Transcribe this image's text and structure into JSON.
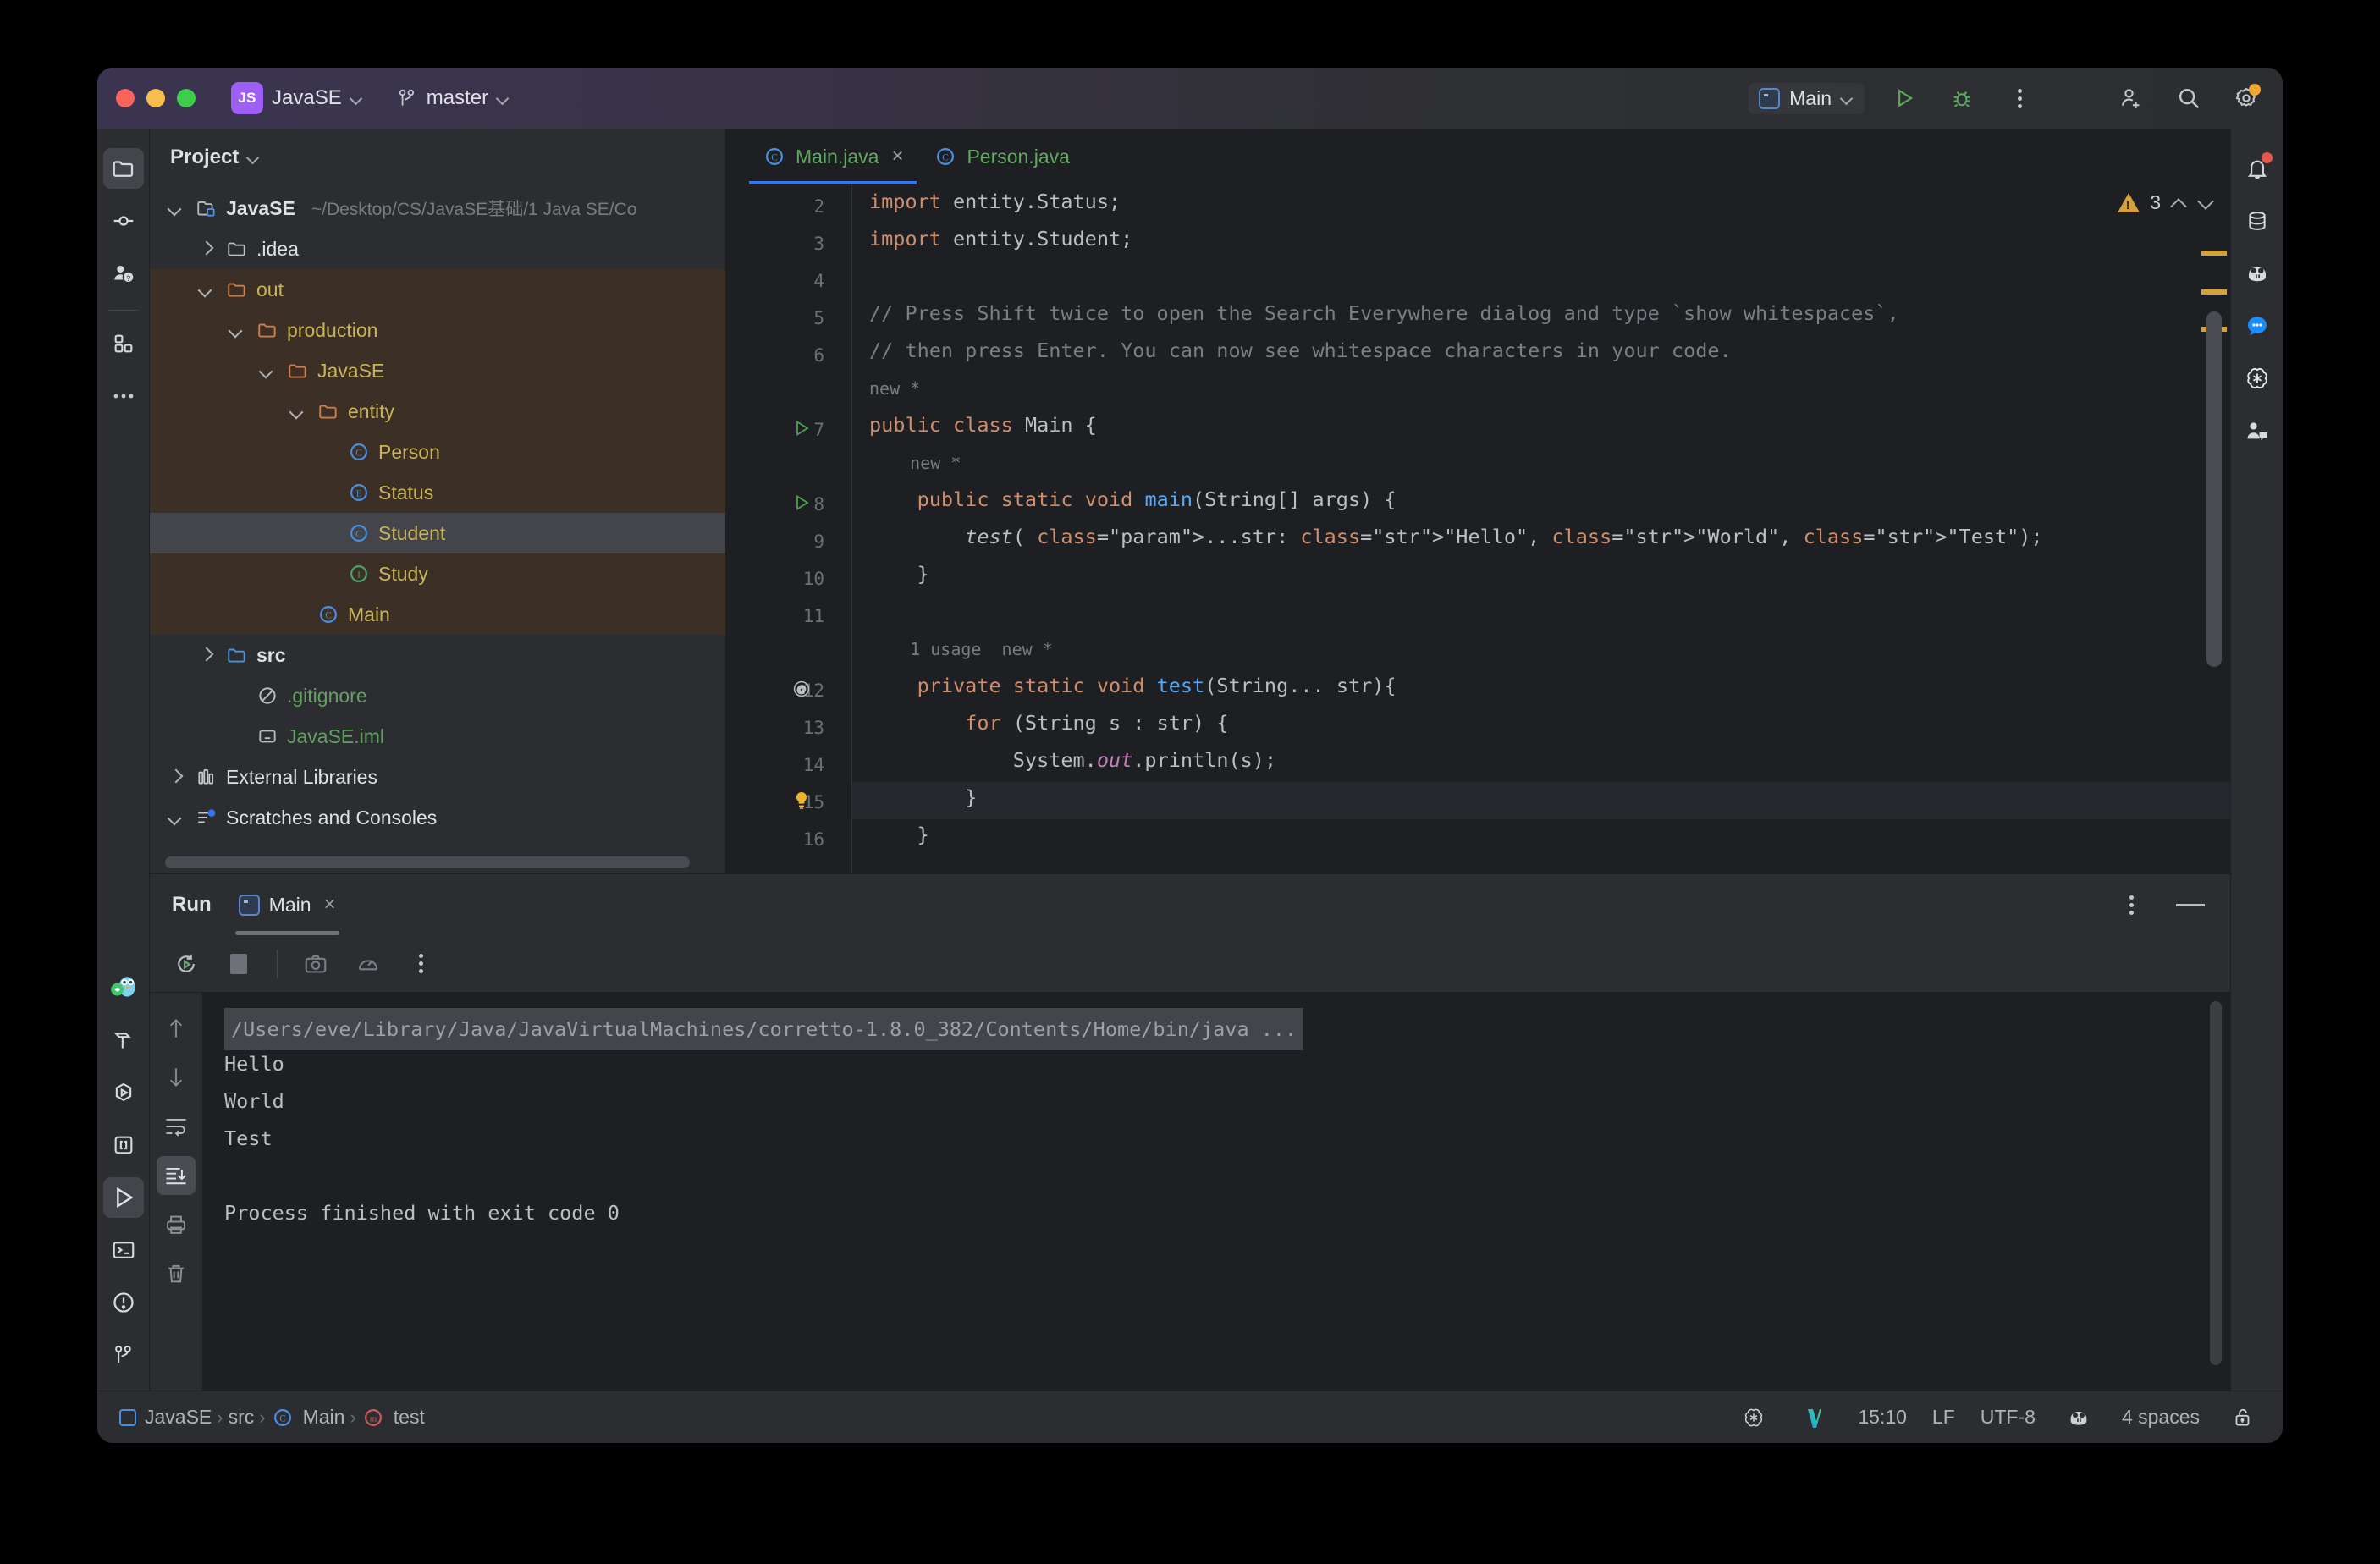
{
  "window": {
    "project_name": "JavaSE",
    "project_badge": "JS",
    "branch": "master"
  },
  "toolbar": {
    "run_config": "Main",
    "run_label": "run-button",
    "debug_label": "debug-button",
    "more_label": "more-actions",
    "add_user_label": "add-user",
    "search_label": "search-everywhere",
    "settings_label": "settings"
  },
  "project_panel": {
    "title": "Project",
    "tree": [
      {
        "label": "JavaSE",
        "path": "~/Desktop/CS/JavaSE基础/1 Java SE/Co",
        "depth": 0,
        "twist": "d",
        "icon": "module-icon",
        "color": "white",
        "bold": true
      },
      {
        "label": ".idea",
        "path": "",
        "depth": 1,
        "twist": "r",
        "icon": "folder-icon",
        "color": "white",
        "bold": false
      },
      {
        "label": "out",
        "path": "",
        "depth": 1,
        "twist": "d",
        "icon": "folder-orange-icon",
        "color": "yellow",
        "bold": false,
        "group": true
      },
      {
        "label": "production",
        "path": "",
        "depth": 2,
        "twist": "d",
        "icon": "folder-orange-icon",
        "color": "yellow",
        "bold": false,
        "group": true
      },
      {
        "label": "JavaSE",
        "path": "",
        "depth": 3,
        "twist": "d",
        "icon": "folder-orange-icon",
        "color": "yellow",
        "bold": false,
        "group": true
      },
      {
        "label": "entity",
        "path": "",
        "depth": 4,
        "twist": "d",
        "icon": "folder-orange-icon",
        "color": "yellow",
        "bold": false,
        "group": true
      },
      {
        "label": "Person",
        "path": "",
        "depth": 5,
        "twist": "",
        "icon": "class-icon",
        "color": "yellow",
        "bold": false,
        "group": true
      },
      {
        "label": "Status",
        "path": "",
        "depth": 5,
        "twist": "",
        "icon": "enum-icon",
        "color": "yellow",
        "bold": false,
        "group": true
      },
      {
        "label": "Student",
        "path": "",
        "depth": 5,
        "twist": "",
        "icon": "class-icon",
        "color": "yellow",
        "bold": false,
        "group": true,
        "selected": true
      },
      {
        "label": "Study",
        "path": "",
        "depth": 5,
        "twist": "",
        "icon": "interface-icon",
        "color": "yellow",
        "bold": false,
        "group": true
      },
      {
        "label": "Main",
        "path": "",
        "depth": 4,
        "twist": "",
        "icon": "class-icon",
        "color": "yellow",
        "bold": false,
        "group": true
      },
      {
        "label": "src",
        "path": "",
        "depth": 1,
        "twist": "r",
        "icon": "folder-blue-icon",
        "color": "white",
        "bold": true
      },
      {
        "label": ".gitignore",
        "path": "",
        "depth": 2,
        "twist": "",
        "icon": "gitignore-icon",
        "color": "green",
        "bold": false
      },
      {
        "label": "JavaSE.iml",
        "path": "",
        "depth": 2,
        "twist": "",
        "icon": "iml-icon",
        "color": "green",
        "bold": false
      },
      {
        "label": "External Libraries",
        "path": "",
        "depth": 0,
        "twist": "r",
        "icon": "library-icon",
        "color": "white",
        "bold": false
      },
      {
        "label": "Scratches and Consoles",
        "path": "",
        "depth": 0,
        "twist": "d",
        "icon": "scratches-icon",
        "color": "white",
        "bold": false
      }
    ]
  },
  "editor": {
    "tabs": [
      {
        "label": "Main.java",
        "icon": "class-icon",
        "active": true,
        "closable": true
      },
      {
        "label": "Person.java",
        "icon": "class-icon",
        "active": false,
        "closable": false
      }
    ],
    "warning_count": "3",
    "lines": [
      {
        "num": "2",
        "text": "import entity.Status;"
      },
      {
        "num": "3",
        "text": "import entity.Student;"
      },
      {
        "num": "4",
        "text": ""
      },
      {
        "num": "5",
        "text": "// Press Shift twice to open the Search Everywhere dialog and type `show whitespaces`,"
      },
      {
        "num": "6",
        "text": "// then press Enter. You can now see whitespace characters in your code."
      },
      {
        "num": "",
        "text": "new *"
      },
      {
        "num": "7",
        "text": "public class Main {",
        "gutter_icon": "run-gutter-icon"
      },
      {
        "num": "",
        "text": "    new *"
      },
      {
        "num": "8",
        "text": "    public static void main(String[] args) {",
        "gutter_icon": "run-gutter-icon"
      },
      {
        "num": "9",
        "text": "        test( ...str: \"Hello\", \"World\", \"Test\");"
      },
      {
        "num": "10",
        "text": "    }"
      },
      {
        "num": "11",
        "text": ""
      },
      {
        "num": "",
        "text": "    1 usage  new *"
      },
      {
        "num": "12",
        "text": "    private static void test(String... str){",
        "gutter_icon": "annotation-icon"
      },
      {
        "num": "13",
        "text": "        for (String s : str) {"
      },
      {
        "num": "14",
        "text": "            System.out.println(s);"
      },
      {
        "num": "15",
        "text": "        }",
        "gutter_icon": "lightbulb-icon",
        "highlighted": true
      },
      {
        "num": "16",
        "text": "    }"
      }
    ]
  },
  "run_panel": {
    "title": "Run",
    "tab_label": "Main",
    "toolbar": {
      "rerun": "rerun-button",
      "stop": "stop-button",
      "camera": "screenshot-button",
      "profile": "profiler-button",
      "more": "more-options-button"
    },
    "gutter": {
      "up": "scroll-up-button",
      "down": "scroll-down-button",
      "soft_wrap": "soft-wrap-button",
      "scroll_end": "scroll-to-end-button",
      "print": "print-button",
      "clear": "clear-all-button"
    },
    "console": {
      "command": "/Users/eve/Library/Java/JavaVirtualMachines/corretto-1.8.0_382/Contents/Home/bin/java ...",
      "output": [
        "Hello",
        "World",
        "Test",
        "",
        "Process finished with exit code 0"
      ]
    }
  },
  "status_bar": {
    "breadcrumbs": [
      {
        "label": "JavaSE",
        "icon": "module-icon"
      },
      {
        "label": "src",
        "icon": ""
      },
      {
        "label": "Main",
        "icon": "class-icon"
      },
      {
        "label": "test",
        "icon": "method-icon"
      }
    ],
    "time": "15:10",
    "line_sep": "LF",
    "encoding": "UTF-8",
    "indent": "4 spaces"
  },
  "colors": {
    "accent": "#3574f0",
    "badge_purple": "#9d5ff5",
    "warning": "#d4a23c",
    "string_green": "#6aab73",
    "keyword_orange": "#cf8e6d",
    "method_blue": "#56a8f5"
  }
}
